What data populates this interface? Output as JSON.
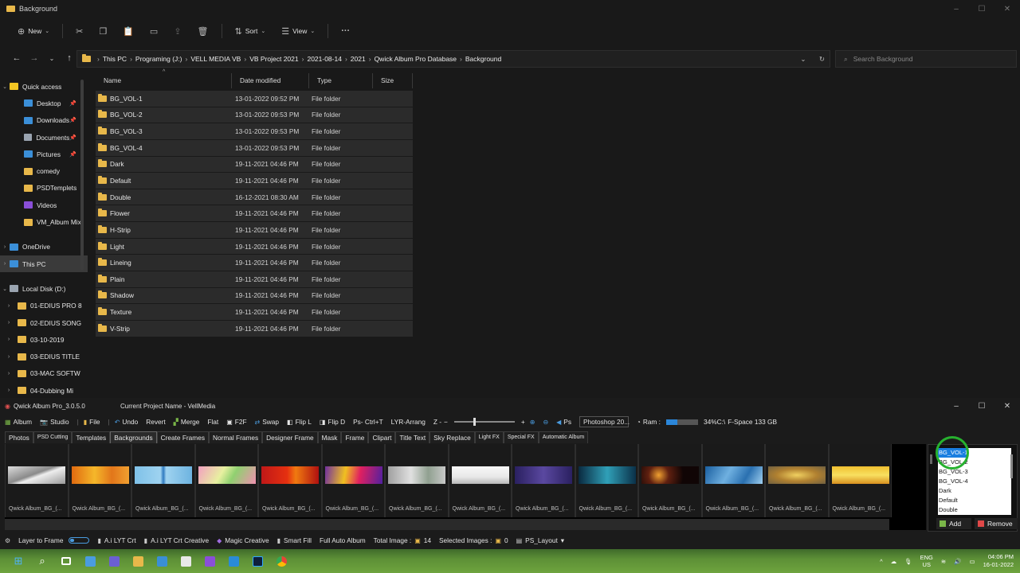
{
  "explorer": {
    "title": "Background",
    "window_controls": [
      "–",
      "☐",
      "✕"
    ],
    "toolbar": {
      "new_label": "New",
      "sort_label": "Sort",
      "view_label": "View",
      "more_label": "···"
    },
    "breadcrumb": [
      "This PC",
      "Programing (J:)",
      "VELL MEDIA VB",
      "VB Project 2021",
      "2021-08-14",
      "2021",
      "Qwick Album Pro Database",
      "Background"
    ],
    "search_placeholder": "Search Background",
    "nav": [
      {
        "label": "Quick access",
        "icon": "star-icon",
        "expand": "v",
        "color": "#f3c623"
      },
      {
        "label": "Desktop",
        "icon": "desktop-icon",
        "pin": true,
        "color": "#3b8fd8"
      },
      {
        "label": "Downloads",
        "icon": "download-icon",
        "pin": true,
        "color": "#3b8fd8"
      },
      {
        "label": "Documents",
        "icon": "document-icon",
        "pin": true,
        "color": "#9aa4b0"
      },
      {
        "label": "Pictures",
        "icon": "pictures-icon",
        "pin": true,
        "color": "#3b8fd8"
      },
      {
        "label": "comedy",
        "icon": "folder-icon",
        "color": "#e8b84a"
      },
      {
        "label": "PSDTemplets",
        "icon": "folder-icon",
        "color": "#e8b84a"
      },
      {
        "label": "Videos",
        "icon": "video-icon",
        "color": "#8a4fd8"
      },
      {
        "label": "VM_Album Mix",
        "icon": "folder-icon",
        "color": "#e8b84a"
      },
      {
        "label": "OneDrive",
        "icon": "cloud-icon",
        "expand": ">",
        "color": "#3b8fd8"
      },
      {
        "label": "This PC",
        "icon": "pc-icon",
        "expand": ">",
        "color": "#3b8fd8",
        "selected": true
      },
      {
        "label": "Local Disk (D:)",
        "icon": "drive-icon",
        "expand": "v",
        "color": "#9aa4b0"
      },
      {
        "label": "01-EDIUS PRO 8",
        "icon": "folder-icon",
        "expand": ">",
        "color": "#e8b84a"
      },
      {
        "label": "02-EDIUS SONG",
        "icon": "folder-icon",
        "expand": ">",
        "color": "#e8b84a"
      },
      {
        "label": "03-10-2019",
        "icon": "folder-icon",
        "expand": ">",
        "color": "#e8b84a"
      },
      {
        "label": "03-EDIUS TITLE",
        "icon": "folder-icon",
        "expand": ">",
        "color": "#e8b84a"
      },
      {
        "label": "03-MAC SOFTW",
        "icon": "folder-icon",
        "expand": ">",
        "color": "#e8b84a"
      },
      {
        "label": "04-Dubbing Mi",
        "icon": "folder-icon",
        "expand": ">",
        "color": "#e8b84a"
      }
    ],
    "columns": [
      "Name",
      "Date modified",
      "Type",
      "Size"
    ],
    "files": [
      {
        "name": "BG_VOL-1",
        "date": "13-01-2022 09:52 PM",
        "type": "File folder"
      },
      {
        "name": "BG_VOL-2",
        "date": "13-01-2022 09:53 PM",
        "type": "File folder"
      },
      {
        "name": "BG_VOL-3",
        "date": "13-01-2022 09:53 PM",
        "type": "File folder"
      },
      {
        "name": "BG_VOL-4",
        "date": "13-01-2022 09:53 PM",
        "type": "File folder"
      },
      {
        "name": "Dark",
        "date": "19-11-2021 04:46 PM",
        "type": "File folder"
      },
      {
        "name": "Default",
        "date": "19-11-2021 04:46 PM",
        "type": "File folder"
      },
      {
        "name": "Double",
        "date": "16-12-2021 08:30 AM",
        "type": "File folder"
      },
      {
        "name": "Flower",
        "date": "19-11-2021 04:46 PM",
        "type": "File folder"
      },
      {
        "name": "H-Strip",
        "date": "19-11-2021 04:46 PM",
        "type": "File folder"
      },
      {
        "name": "Light",
        "date": "19-11-2021 04:46 PM",
        "type": "File folder"
      },
      {
        "name": "Lineing",
        "date": "19-11-2021 04:46 PM",
        "type": "File folder"
      },
      {
        "name": "Plain",
        "date": "19-11-2021 04:46 PM",
        "type": "File folder"
      },
      {
        "name": "Shadow",
        "date": "19-11-2021 04:46 PM",
        "type": "File folder"
      },
      {
        "name": "Texture",
        "date": "19-11-2021 04:46 PM",
        "type": "File folder"
      },
      {
        "name": "V-Strip",
        "date": "19-11-2021 04:46 PM",
        "type": "File folder"
      }
    ]
  },
  "qwick": {
    "title": "Qwick Album Pro_3.0.5.0",
    "project": "Current Project Name - VellMedia",
    "toolbar": {
      "album": "Album",
      "studio": "Studio",
      "file": "File",
      "undo": "Undo",
      "revert": "Revert",
      "merge": "Merge",
      "flat": "Flat",
      "f2f": "F2F",
      "swap": "Swap",
      "flip_l": "Flip L",
      "flip_d": "Flip D",
      "ps_ctrl": "Ps- Ctrl+T",
      "lyr": "LYR-Arrang",
      "zoom": "Z -",
      "ps": "Ps",
      "ps_version": "Photoshop 20...",
      "ram": "Ram :",
      "ram_pct": "34%C:\\",
      "fspace": "F-Space 133 GB"
    },
    "ram_level": 0.34,
    "tabs": [
      {
        "label": "Photos"
      },
      {
        "label": "PSD Cutting",
        "small": true
      },
      {
        "label": "Templates"
      },
      {
        "label": "Backgrounds",
        "active": true
      },
      {
        "label": "Create Frames"
      },
      {
        "label": "Normal Frames"
      },
      {
        "label": "Designer Frame"
      },
      {
        "label": "Mask"
      },
      {
        "label": "Frame"
      },
      {
        "label": "Clipart"
      },
      {
        "label": "Title Text"
      },
      {
        "label": "Sky Replace"
      },
      {
        "label": "Light FX",
        "small": true
      },
      {
        "label": "Special FX",
        "small": true
      },
      {
        "label": "Automatic Album",
        "small": true
      }
    ],
    "thumb_caption": "Qwick Album_BG_(...",
    "thumb_colors": [
      "linear-gradient(160deg,#ddd 0%,#8a8a8a 45%,#eee 55%,#999 100%)",
      "linear-gradient(90deg,#e06a10,#f5b72a 40%,#e2761a 70%,#f0a030)",
      "linear-gradient(90deg,#7fc1e8,#9fd3f0 45%,#2f7ac0 50%,#9fd3f0 55%,#6db3e0)",
      "linear-gradient(120deg,#f2a0c0,#e8f0a0 40%,#90d070 60%,#f090b0)",
      "linear-gradient(90deg,#c01818,#e53010 45%,#f07a10 60%,#b01010)",
      "linear-gradient(100deg,#7030a0,#f0c020 35%,#e02060 60%,#5020a0)",
      "linear-gradient(90deg,#a0a0a0,#e0e0e0 40%,#90a090 70%,#c8c8c8)",
      "linear-gradient(180deg,#f8f8f8,#e8e8e8 60%,#b8b8b8)",
      "linear-gradient(90deg,#2a2060,#5a48a0 50%,#2a2060)",
      "linear-gradient(90deg,#0a2a40,#30a0b8 50%,#0a3048)",
      "radial-gradient(circle at 30% 50%,#f0a030 0%,#602010 25%,#100505 60%)",
      "linear-gradient(120deg,#1a5fa0,#6fb0e0 40%,#2a70b0 70%,#a0d0f0)",
      "radial-gradient(ellipse at 50% 50%,#f0d060 0%,#b08030 50%,#706040 100%)",
      "linear-gradient(180deg,#f0c030,#f8e060 50%,#d89020)"
    ],
    "list_items": [
      "BG_VOL-1",
      "BG_VOL-2",
      "BG_VOL-3",
      "BG_VOL-4",
      "Dark",
      "Default",
      "Double"
    ],
    "add_label": "Add",
    "remove_label": "Remove",
    "status": {
      "layer_to_frame": "Layer to Frame",
      "aj_lyt": "A.i LYT Crt",
      "aj_lyt_creative": "A.i LYT Crt Creative",
      "magic": "Magic Creative",
      "smart": "Smart Fill",
      "full_auto": "Full Auto Album",
      "total_label": "Total Image :",
      "total_value": "14",
      "selected_label": "Selected Images :",
      "selected_value": "0",
      "ps_layout": "PS_Layout"
    }
  },
  "taskbar": {
    "lang_top": "ENG",
    "lang_bottom": "US",
    "time": "04:06 PM",
    "date": "16-01-2022"
  }
}
